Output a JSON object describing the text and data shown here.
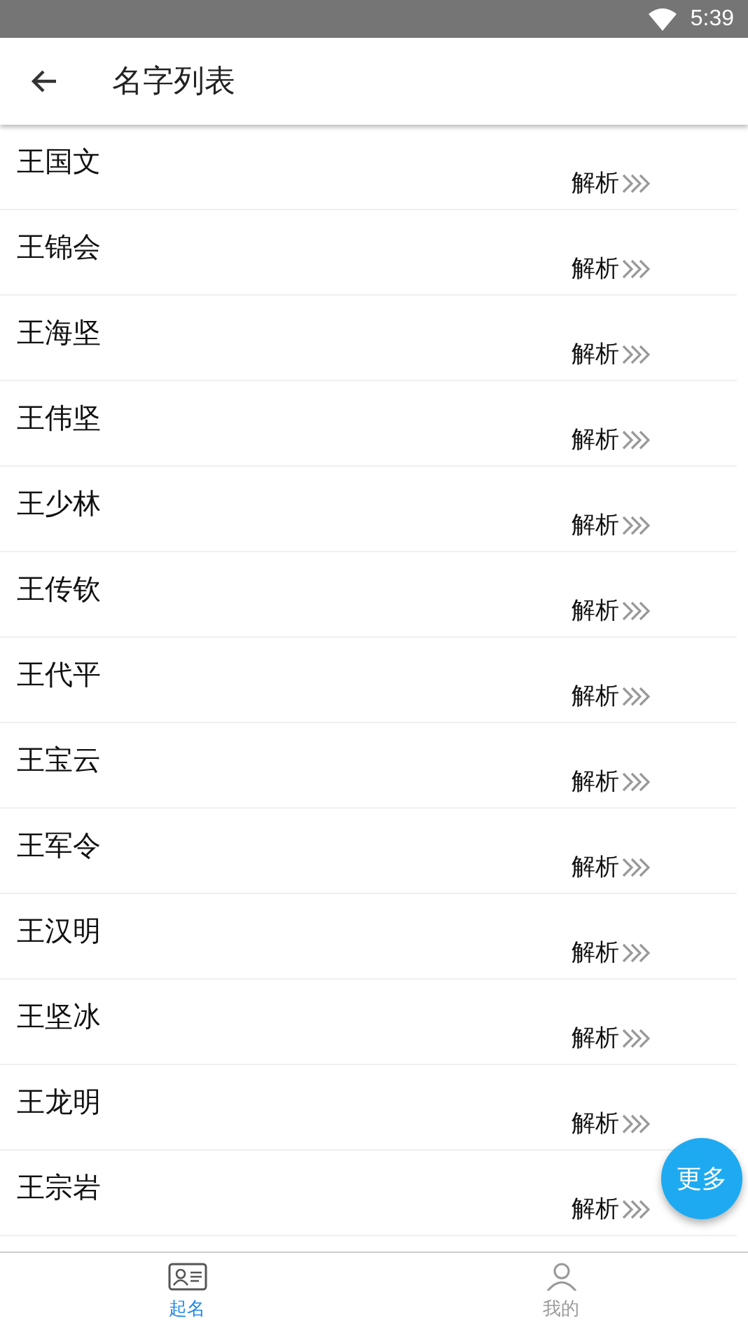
{
  "status_bar": {
    "time": "5:39"
  },
  "app_bar": {
    "title": "名字列表"
  },
  "names": [
    {
      "name": "王国文",
      "action": "解析"
    },
    {
      "name": "王锦会",
      "action": "解析"
    },
    {
      "name": "王海坚",
      "action": "解析"
    },
    {
      "name": "王伟坚",
      "action": "解析"
    },
    {
      "name": "王少林",
      "action": "解析"
    },
    {
      "name": "王传钦",
      "action": "解析"
    },
    {
      "name": "王代平",
      "action": "解析"
    },
    {
      "name": "王宝云",
      "action": "解析"
    },
    {
      "name": "王军令",
      "action": "解析"
    },
    {
      "name": "王汉明",
      "action": "解析"
    },
    {
      "name": "王坚冰",
      "action": "解析"
    },
    {
      "name": "王龙明",
      "action": "解析"
    },
    {
      "name": "王宗岩",
      "action": "解析"
    }
  ],
  "fab": {
    "label": "更多"
  },
  "tabs": [
    {
      "label": "起名",
      "selected": true,
      "kind": "card"
    },
    {
      "label": "我的",
      "selected": false,
      "kind": "person"
    }
  ]
}
